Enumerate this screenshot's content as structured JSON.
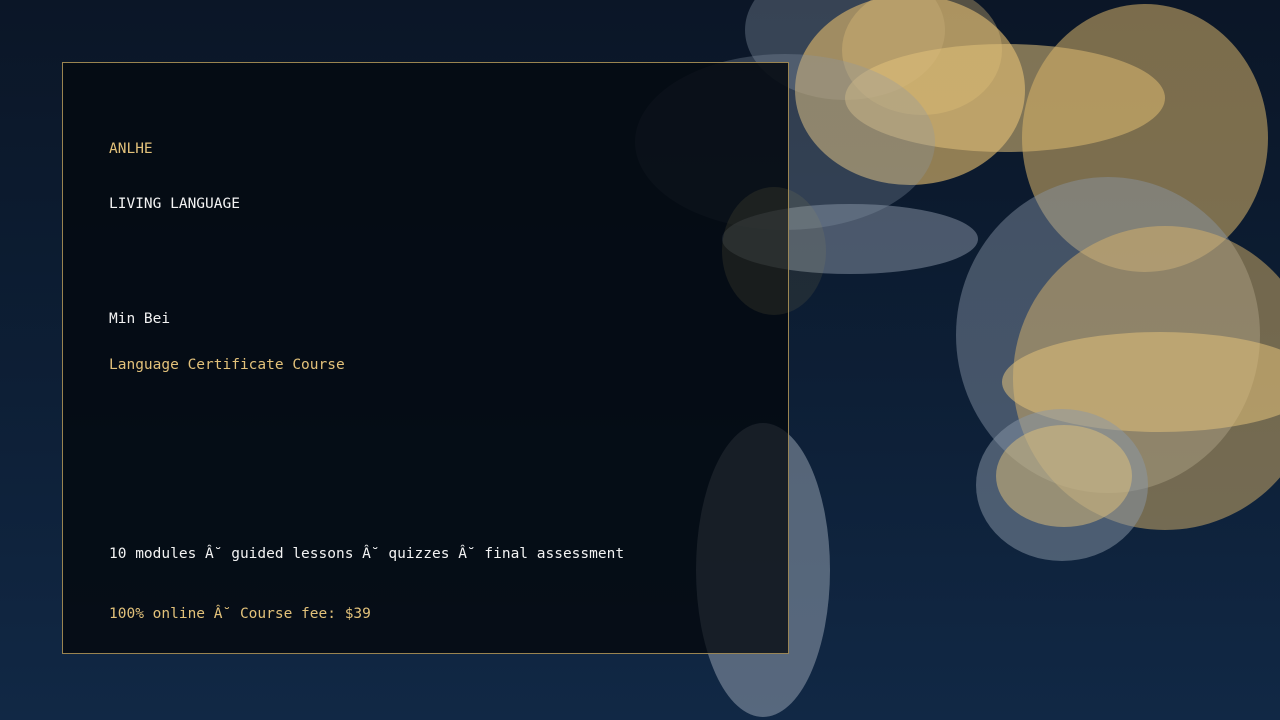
{
  "colors": {
    "accent_gold": "#e2c17a",
    "text_white": "#f3f3f3",
    "card_border": "#9a8450",
    "background_top": "#0b1627",
    "background_bottom": "#112845",
    "bokeh_gold": "#d9b46a",
    "bokeh_grey": "#8a97a8"
  },
  "card": {
    "brand": "ANLHE",
    "tagline": "LIVING LANGUAGE",
    "language": "Min Bei",
    "course_title": "Language Certificate Course",
    "details": "10 modules Â˘ guided lessons Â˘ quizzes Â˘ final assessment",
    "pricing": "100% online Â˘ Course fee: $39"
  }
}
